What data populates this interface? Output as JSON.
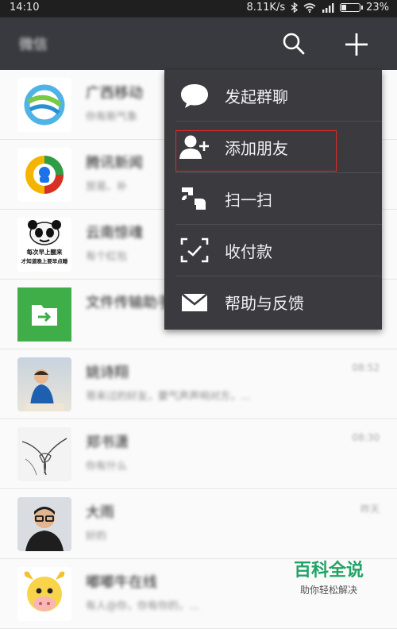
{
  "status_bar": {
    "time": "14:10",
    "network_speed": "8.11K/s",
    "battery_percent": "23%",
    "battery_level": 0.23
  },
  "titlebar": {
    "title": "微信",
    "search_icon": "search-icon",
    "plus_icon": "plus-icon",
    "background": "#393a3f"
  },
  "chats": [
    {
      "name": "广西移动",
      "preview": "你有新气象",
      "time": "",
      "avatar_icon": "china-mobile-logo"
    },
    {
      "name": "腾讯新闻",
      "preview": "贸易、补",
      "time": "",
      "avatar_icon": "tencent-news-logo"
    },
    {
      "name": "云南惊魂",
      "preview": "有个红包",
      "time": "",
      "avatar_icon": "panda-meme-avatar",
      "avatar_text": "每次早上醒来\n才知道晚上要早点睡"
    },
    {
      "name": "文件传输助手",
      "preview": "",
      "time": "",
      "avatar_icon": "file-transfer-icon"
    },
    {
      "name": "姚诗翔",
      "preview": "哥来过的好友，要气声声响对方，…",
      "time": "08:52",
      "avatar_icon": "child-photo-avatar"
    },
    {
      "name": "郑书潇",
      "preview": "你有什么",
      "time": "08:30",
      "avatar_icon": "hands-sketch-avatar"
    },
    {
      "name": "大雨",
      "preview": "好的",
      "time": "昨天",
      "avatar_icon": "man-photo-avatar"
    },
    {
      "name": "嘟嘟牛在线",
      "preview": "有人@你，你有你的，…",
      "time": "",
      "avatar_icon": "cow-cartoon-avatar"
    }
  ],
  "menu": {
    "background": "#3a3a3f",
    "items": [
      {
        "label": "发起群聊",
        "icon": "chat-bubble-icon"
      },
      {
        "label": "添加朋友",
        "icon": "add-friend-icon"
      },
      {
        "label": "扫一扫",
        "icon": "scan-icon"
      },
      {
        "label": "收付款",
        "icon": "payment-scan-icon"
      },
      {
        "label": "帮助与反馈",
        "icon": "mail-icon"
      }
    ]
  },
  "highlight_color": "#e02a2a",
  "watermark": {
    "main": "百科全说",
    "sub": "助你轻松解决",
    "color": "#21a366"
  }
}
